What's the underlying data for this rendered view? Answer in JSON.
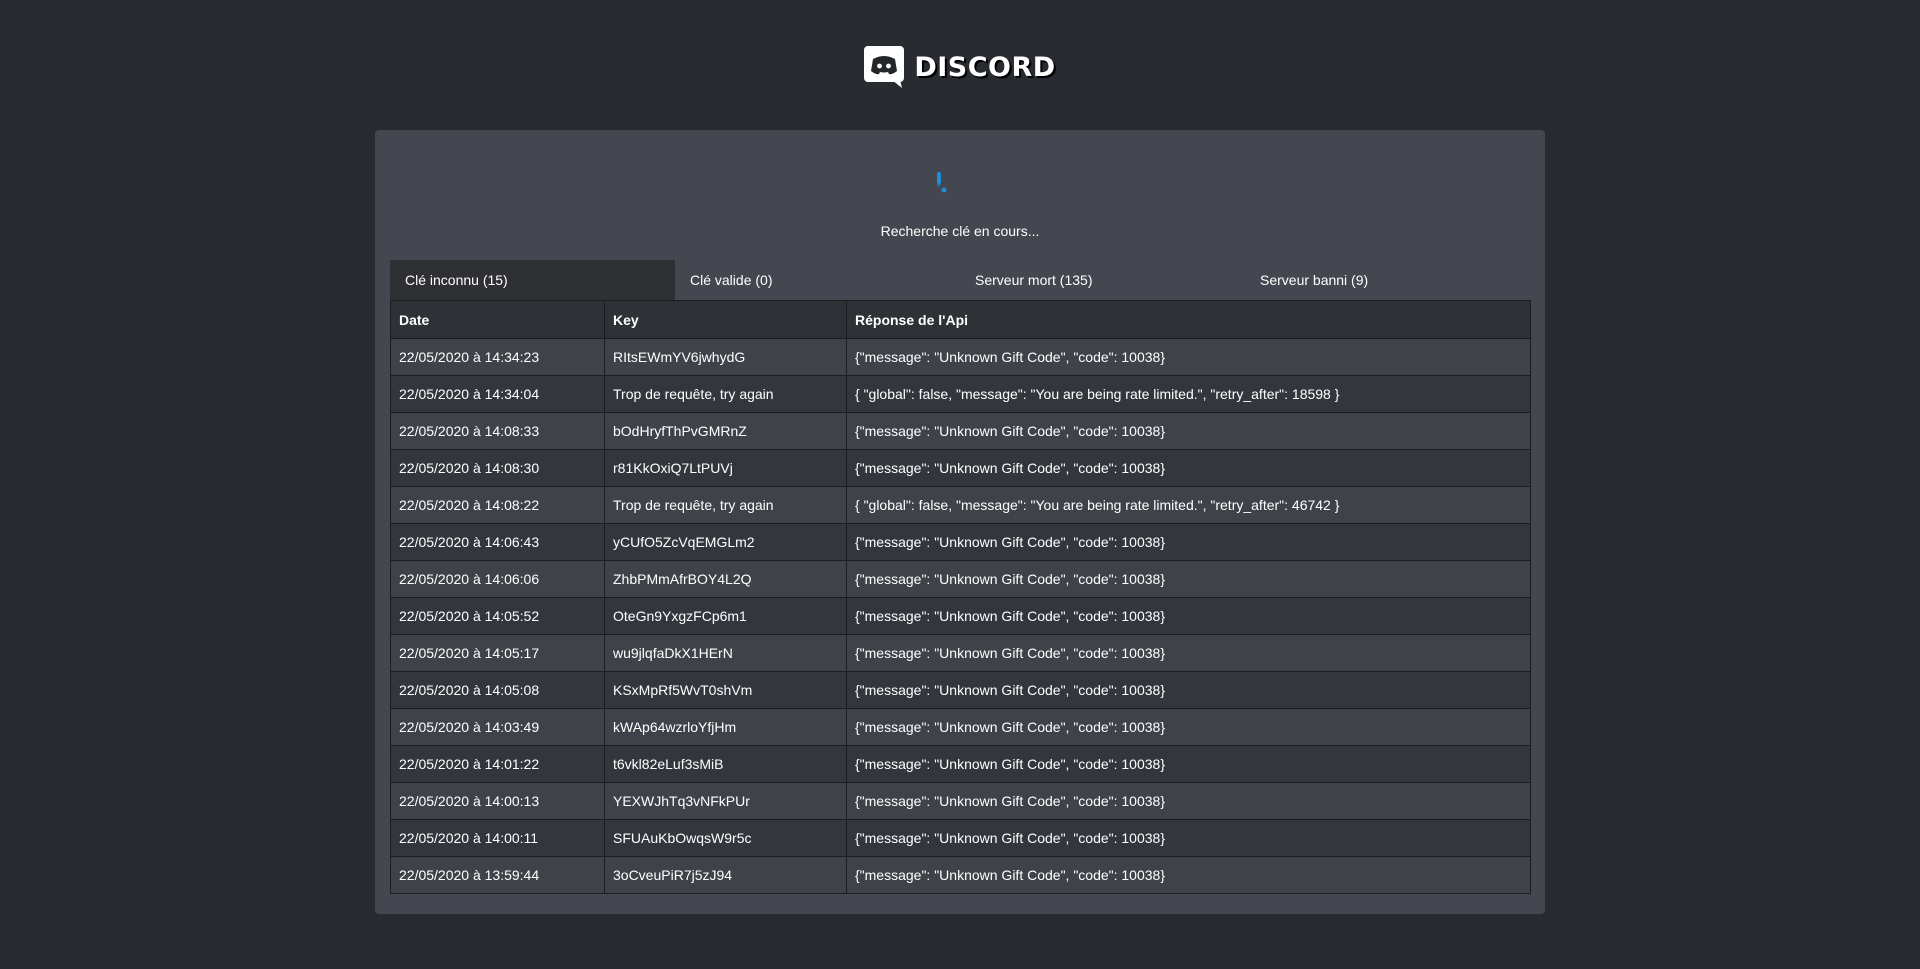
{
  "header": {
    "logo_text": "DISCORD",
    "logo_icon": "discord-icon"
  },
  "status": {
    "text": "Recherche clé en cours...",
    "spinner_icon": "loading-spinner-icon",
    "spinner_color": "#1e90d8"
  },
  "tabs": [
    {
      "label": "Clé inconnu (15)",
      "active": true
    },
    {
      "label": "Clé valide (0)",
      "active": false
    },
    {
      "label": "Serveur mort (135)",
      "active": false
    },
    {
      "label": "Serveur banni (9)",
      "active": false
    }
  ],
  "table": {
    "headers": [
      "Date",
      "Key",
      "Réponse de l'Api"
    ],
    "rows": [
      [
        "22/05/2020 à 14:34:23",
        "RItsEWmYV6jwhydG",
        "{\"message\": \"Unknown Gift Code\", \"code\": 10038}"
      ],
      [
        "22/05/2020 à 14:34:04",
        "Trop de requête, try again",
        "{ \"global\": false, \"message\": \"You are being rate limited.\", \"retry_after\": 18598 }"
      ],
      [
        "22/05/2020 à 14:08:33",
        "bOdHryfThPvGMRnZ",
        "{\"message\": \"Unknown Gift Code\", \"code\": 10038}"
      ],
      [
        "22/05/2020 à 14:08:30",
        "r81KkOxiQ7LtPUVj",
        "{\"message\": \"Unknown Gift Code\", \"code\": 10038}"
      ],
      [
        "22/05/2020 à 14:08:22",
        "Trop de requête, try again",
        "{ \"global\": false, \"message\": \"You are being rate limited.\", \"retry_after\": 46742 }"
      ],
      [
        "22/05/2020 à 14:06:43",
        "yCUfO5ZcVqEMGLm2",
        "{\"message\": \"Unknown Gift Code\", \"code\": 10038}"
      ],
      [
        "22/05/2020 à 14:06:06",
        "ZhbPMmAfrBOY4L2Q",
        "{\"message\": \"Unknown Gift Code\", \"code\": 10038}"
      ],
      [
        "22/05/2020 à 14:05:52",
        "OteGn9YxgzFCp6m1",
        "{\"message\": \"Unknown Gift Code\", \"code\": 10038}"
      ],
      [
        "22/05/2020 à 14:05:17",
        "wu9jlqfaDkX1HErN",
        "{\"message\": \"Unknown Gift Code\", \"code\": 10038}"
      ],
      [
        "22/05/2020 à 14:05:08",
        "KSxMpRf5WvT0shVm",
        "{\"message\": \"Unknown Gift Code\", \"code\": 10038}"
      ],
      [
        "22/05/2020 à 14:03:49",
        "kWAp64wzrloYfjHm",
        "{\"message\": \"Unknown Gift Code\", \"code\": 10038}"
      ],
      [
        "22/05/2020 à 14:01:22",
        "t6vkl82eLuf3sMiB",
        "{\"message\": \"Unknown Gift Code\", \"code\": 10038}"
      ],
      [
        "22/05/2020 à 14:00:13",
        "YEXWJhTq3vNFkPUr",
        "{\"message\": \"Unknown Gift Code\", \"code\": 10038}"
      ],
      [
        "22/05/2020 à 14:00:11",
        "SFUAuKbOwqsW9r5c",
        "{\"message\": \"Unknown Gift Code\", \"code\": 10038}"
      ],
      [
        "22/05/2020 à 13:59:44",
        "3oCveuPiR7j5zJ94",
        "{\"message\": \"Unknown Gift Code\", \"code\": 10038}"
      ]
    ]
  },
  "colors": {
    "background": "#282b30",
    "panel": "#44474f",
    "active_tab": "#2f3033"
  }
}
